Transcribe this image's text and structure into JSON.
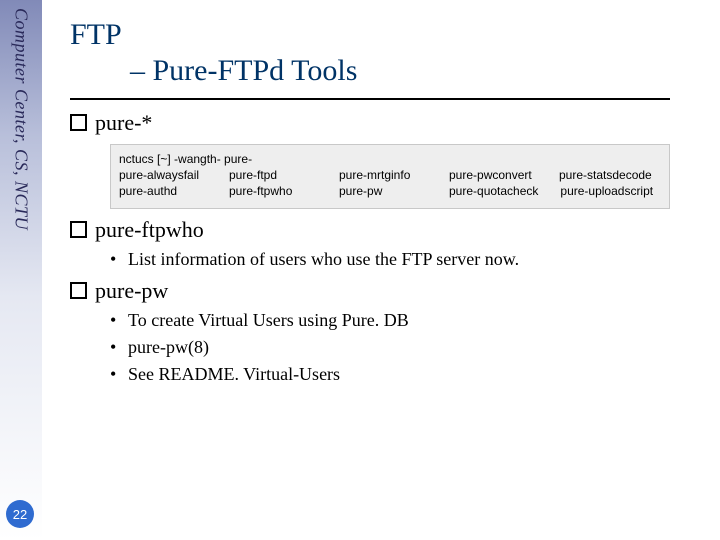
{
  "sidebar_text": "Computer Center, CS, NCTU",
  "page_number": "22",
  "title_line1": "FTP",
  "title_line2": "– Pure-FTPd Tools",
  "sections": {
    "s1": {
      "heading": "pure-*"
    },
    "s2": {
      "heading": "pure-ftpwho",
      "items": [
        "List information of users who use the FTP server now."
      ]
    },
    "s3": {
      "heading": "pure-pw",
      "items": [
        "To create Virtual Users using Pure. DB",
        "pure-pw(8)",
        "See README. Virtual-Users"
      ]
    }
  },
  "terminal": {
    "line1": "nctucs [~] -wangth- pure-",
    "rows": [
      [
        "pure-alwaysfail",
        "pure-ftpd",
        "pure-mrtginfo",
        "pure-pwconvert",
        "pure-statsdecode"
      ],
      [
        "pure-authd",
        "pure-ftpwho",
        "pure-pw",
        "pure-quotacheck",
        "pure-uploadscript"
      ]
    ]
  }
}
